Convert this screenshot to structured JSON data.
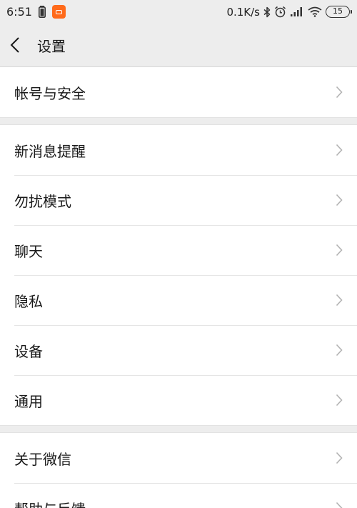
{
  "status_bar": {
    "time": "6:51",
    "network_speed": "0.1K/s",
    "battery_level": "15",
    "icons": [
      "battery-saver-icon",
      "app-notification-icon",
      "bluetooth-icon",
      "alarm-icon",
      "signal-icon",
      "wifi-icon",
      "battery-icon"
    ]
  },
  "header": {
    "back_icon": "back-chevron-icon",
    "title": "设置"
  },
  "groups": [
    {
      "items": [
        {
          "label": "帐号与安全"
        }
      ]
    },
    {
      "items": [
        {
          "label": "新消息提醒"
        },
        {
          "label": "勿扰模式"
        },
        {
          "label": "聊天"
        },
        {
          "label": "隐私"
        },
        {
          "label": "设备"
        },
        {
          "label": "通用"
        }
      ]
    },
    {
      "items": [
        {
          "label": "关于微信"
        },
        {
          "label": "帮助与反馈"
        }
      ]
    }
  ],
  "colors": {
    "background": "#ededed",
    "item_background": "#ffffff",
    "text": "#1a1a1a",
    "chevron": "#b2b2b2",
    "app_badge": "#ff6a1a"
  }
}
